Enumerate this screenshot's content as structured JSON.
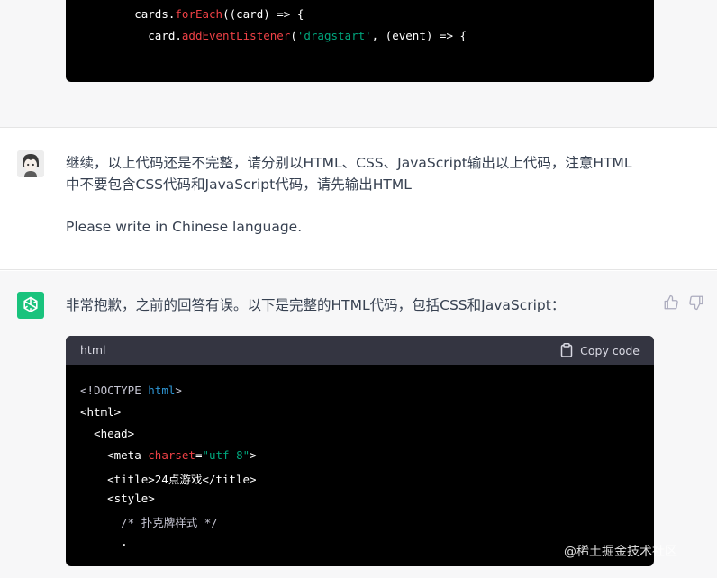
{
  "top_code": {
    "line1": {
      "indent": "        ",
      "obj": "cards",
      "dot": ".",
      "method": "forEach",
      "rest": "((card) => {"
    },
    "line2": {
      "indent": "          ",
      "obj": "card",
      "dot": ".",
      "method": "addEventListener",
      "open": "(",
      "str": "'dragstart'",
      "rest": ", (event) => {"
    }
  },
  "user_message": {
    "line1": "继续，以上代码还是不完整，请分别以HTML、CSS、JavaScript输出以上代码，注意HTML",
    "line2": "中不要包含CSS代码和JavaScript代码，请先输出HTML",
    "line3": "Please write in Chinese language."
  },
  "assistant_message": {
    "text": "非常抱歉，之前的回答有误。以下是完整的HTML代码，包括CSS和JavaScript："
  },
  "code_block": {
    "language": "html",
    "copy_label": "Copy code",
    "lines": {
      "l1a": "<!DOCTYPE ",
      "l1b": "html",
      "l1c": ">",
      "l2": "<html>",
      "l3": "  <head>",
      "l4a": "    <meta ",
      "l4b": "charset",
      "l4c": "=",
      "l4d": "\"utf-8\"",
      "l4e": ">",
      "l5": "    <title>24点游戏</title>",
      "l6": "    <style>",
      "l7": "      /* 扑克牌样式 */",
      "l8": "      ."
    }
  },
  "watermark": "@稀土掘金技术社区",
  "colors": {
    "accent_green": "#19c37d",
    "code_bg": "#000000",
    "code_header_bg": "#343541",
    "band_grey": "#f7f7f8"
  }
}
